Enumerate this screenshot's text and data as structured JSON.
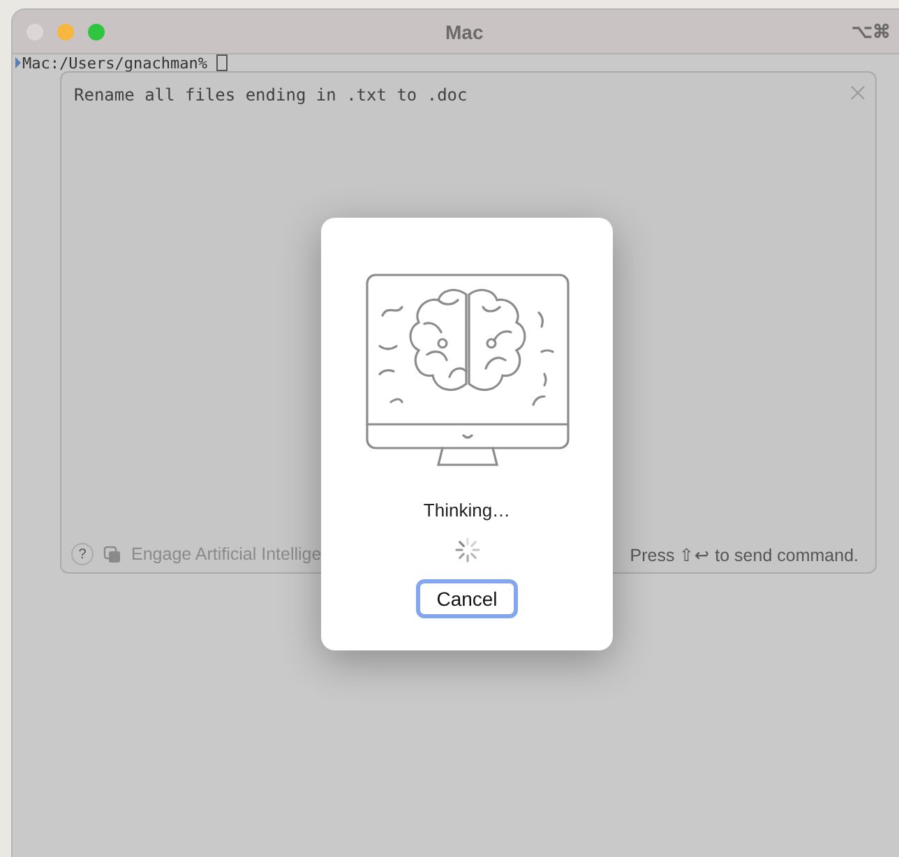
{
  "window": {
    "title": "Mac",
    "shortcut": "⌥⌘"
  },
  "terminal": {
    "prompt": "Mac:/Users/gnachman%"
  },
  "composer": {
    "text": "Rename all files ending in .txt to .doc",
    "help": "?",
    "engage_label": "Engage Artificial Intellige",
    "hint": "Press ⇧↩ to send command."
  },
  "dialog": {
    "status": "Thinking…",
    "buttons": [
      {
        "label": "Cancel",
        "selected": true
      }
    ]
  }
}
